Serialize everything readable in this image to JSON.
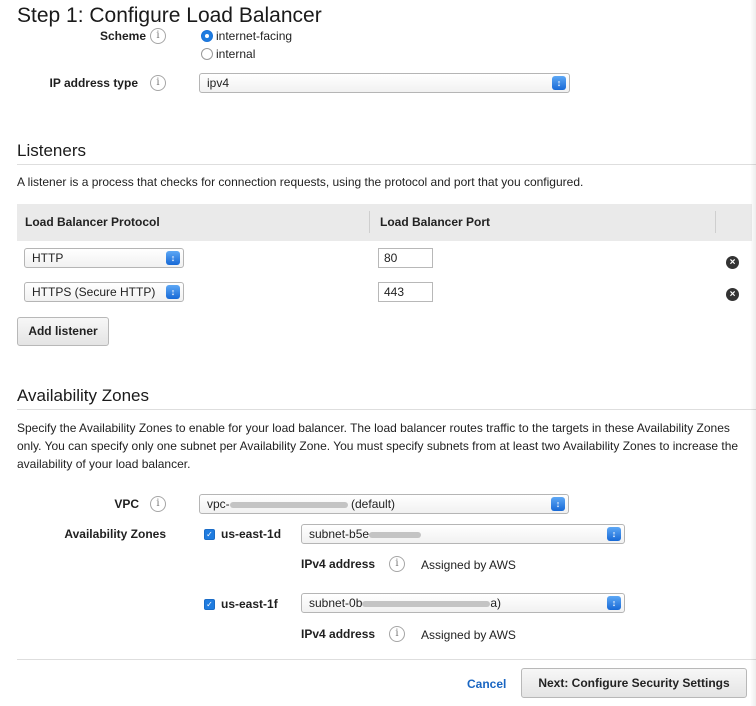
{
  "page": {
    "title": "Step 1: Configure Load Balancer"
  },
  "info_glyph": "i",
  "scheme": {
    "label": "Scheme",
    "options": [
      {
        "label": "internet-facing",
        "selected": true
      },
      {
        "label": "internal",
        "selected": false
      }
    ]
  },
  "ip_address_type": {
    "label": "IP address type",
    "value": "ipv4"
  },
  "listeners": {
    "title": "Listeners",
    "description": "A listener is a process that checks for connection requests, using the protocol and port that you configured.",
    "columns": [
      "Load Balancer Protocol",
      "Load Balancer Port"
    ],
    "rows": [
      {
        "protocol": "HTTP",
        "port": "80"
      },
      {
        "protocol": "HTTPS (Secure HTTP)",
        "port": "443"
      }
    ],
    "add_label": "Add listener"
  },
  "availability_zones": {
    "title": "Availability Zones",
    "description": "Specify the Availability Zones to enable for your load balancer. The load balancer routes traffic to the targets in these Availability Zones only. You can specify only one subnet per Availability Zone. You must specify subnets from at least two Availability Zones to increase the availability of your load balancer.",
    "vpc_label": "VPC",
    "vpc": {
      "prefix": "vpc-",
      "suffix": "(default)"
    },
    "zones_label": "Availability Zones",
    "zones": [
      {
        "name": "us-east-1d",
        "checked": true,
        "subnet_prefix": "subnet-b5e",
        "subnet_suffix": "",
        "ipv4_label": "IPv4 address",
        "ipv4_value": "Assigned by AWS"
      },
      {
        "name": "us-east-1f",
        "checked": true,
        "subnet_prefix": "subnet-0b",
        "subnet_suffix": "a)",
        "ipv4_label": "IPv4 address",
        "ipv4_value": "Assigned by AWS"
      }
    ]
  },
  "footer": {
    "cancel": "Cancel",
    "next": "Next: Configure Security Settings"
  },
  "colors": {
    "link": "#1a66c2",
    "accent": "#1f7ce0",
    "header_bg": "#eaeaea"
  }
}
